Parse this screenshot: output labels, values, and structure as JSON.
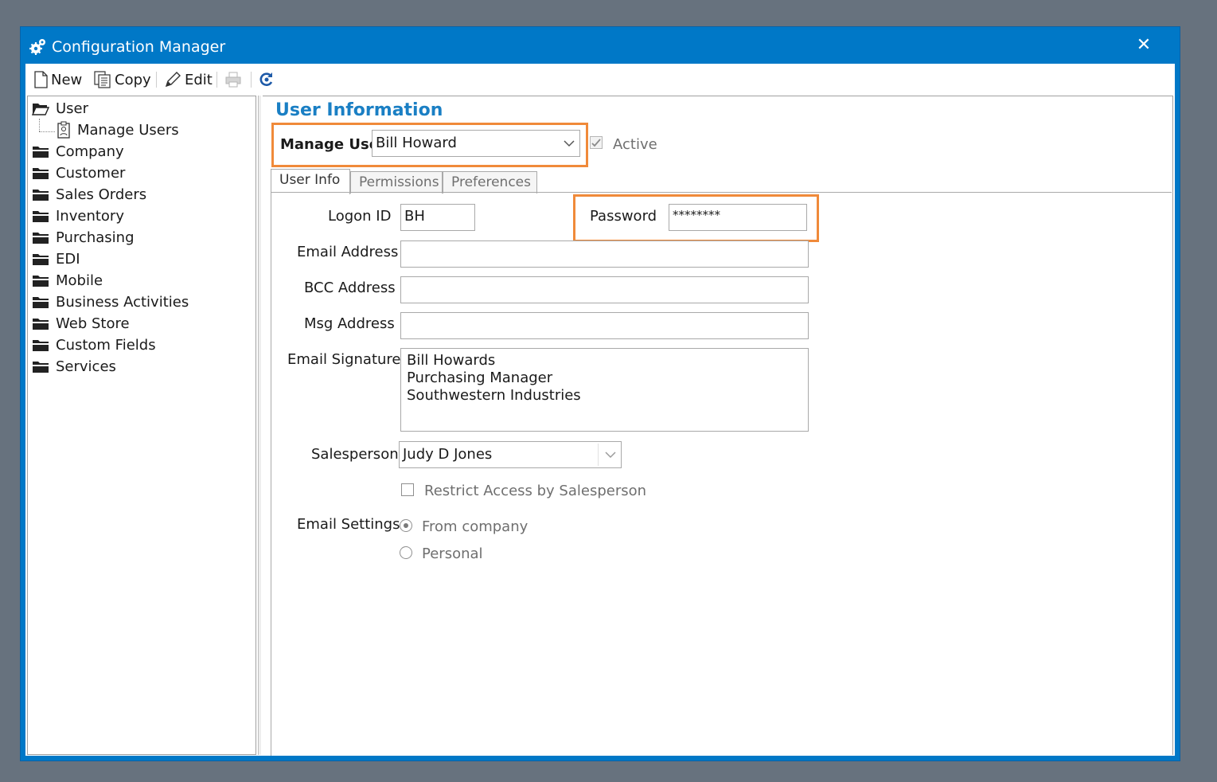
{
  "window": {
    "title": "Configuration Manager",
    "close_label": "✕"
  },
  "toolbar": {
    "new_label": "New",
    "copy_label": "Copy",
    "edit_label": "Edit",
    "icons": [
      "new-doc-icon",
      "copy-icon",
      "edit-icon",
      "print-icon",
      "refresh-icon"
    ]
  },
  "tree": {
    "items": [
      {
        "label": "User",
        "icon": "folder-open-icon"
      },
      {
        "label": "Manage Users",
        "icon": "user-clipboard-icon"
      },
      {
        "label": "Company",
        "icon": "folder-icon"
      },
      {
        "label": "Customer",
        "icon": "folder-icon"
      },
      {
        "label": "Sales Orders",
        "icon": "folder-icon"
      },
      {
        "label": "Inventory",
        "icon": "folder-icon"
      },
      {
        "label": "Purchasing",
        "icon": "folder-icon"
      },
      {
        "label": "EDI",
        "icon": "folder-icon"
      },
      {
        "label": "Mobile",
        "icon": "folder-icon"
      },
      {
        "label": "Business Activities",
        "icon": "folder-icon"
      },
      {
        "label": "Web Store",
        "icon": "folder-icon"
      },
      {
        "label": "Custom Fields",
        "icon": "folder-icon"
      },
      {
        "label": "Services",
        "icon": "folder-icon"
      }
    ]
  },
  "main": {
    "section_title": "User Information",
    "manage_user_label": "Manage User",
    "manage_user_value": "Bill Howard",
    "active_label": "Active",
    "tabs": [
      {
        "label": "User Info"
      },
      {
        "label": "Permissions"
      },
      {
        "label": "Preferences"
      }
    ],
    "form": {
      "logon_id_label": "Logon ID",
      "logon_id_value": "BH",
      "password_label": "Password",
      "password_value": "********",
      "email_label": "Email Address",
      "email_value": "",
      "bcc_label": "BCC Address",
      "bcc_value": "",
      "msg_label": "Msg Address",
      "msg_value": "",
      "signature_label": "Email Signature",
      "signature_lines": [
        "Bill Howards",
        "Purchasing Manager",
        "Southwestern Industries"
      ],
      "salesperson_label": "Salesperson",
      "salesperson_value": "Judy D Jones",
      "restrict_label": "Restrict Access by Salesperson",
      "email_settings_label": "Email Settings",
      "radio_from_company": "From company",
      "radio_personal": "Personal"
    }
  },
  "colors": {
    "titlebar": "#0078c7",
    "accent_title": "#1a7fc4",
    "highlight": "#f08a3a"
  }
}
